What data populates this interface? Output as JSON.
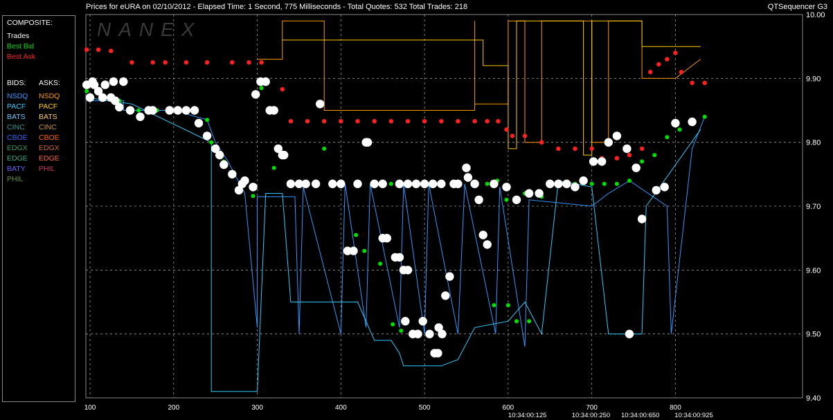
{
  "header": {
    "title_left": "Prices for  eURA  on  02/10/2012  -  Elapsed Time: 1 Second, 775 Milliseconds   -  Total Quotes: 532  Total Trades: 218",
    "title_right": "QTSequencer G3"
  },
  "watermark": "NANEX",
  "legend": {
    "composite_heading": "COMPOSITE:",
    "composite": [
      {
        "label": "Trades",
        "color": "#ffffff"
      },
      {
        "label": "Best Bid",
        "color": "#00e000"
      },
      {
        "label": "Best Ask",
        "color": "#ff2020"
      }
    ],
    "bids_heading": "BIDS:",
    "asks_heading": "ASKS:",
    "bids": [
      {
        "label": "NSDQ",
        "color": "#3399ff"
      },
      {
        "label": "PACF",
        "color": "#33ccff"
      },
      {
        "label": "BATS",
        "color": "#66ccff"
      },
      {
        "label": "CINC",
        "color": "#339999"
      },
      {
        "label": "CBOE",
        "color": "#3366ff"
      },
      {
        "label": "EDGX",
        "color": "#339966"
      },
      {
        "label": "EDGE",
        "color": "#33aa88"
      },
      {
        "label": "BATY",
        "color": "#6666ff"
      },
      {
        "label": "PHIL",
        "color": "#669933"
      }
    ],
    "asks": [
      {
        "label": "NSDQ",
        "color": "#ff9900"
      },
      {
        "label": "PACF",
        "color": "#ffcc00"
      },
      {
        "label": "BATS",
        "color": "#ffcc66"
      },
      {
        "label": "CINC",
        "color": "#cc9933"
      },
      {
        "label": "CBOE",
        "color": "#ff6600"
      },
      {
        "label": "EDGX",
        "color": "#cc6633"
      },
      {
        "label": "EDGE",
        "color": "#ff6633"
      },
      {
        "label": "PHIL",
        "color": "#cc3366"
      }
    ]
  },
  "chart_data": {
    "type": "scatter",
    "xlim": [
      95,
      952
    ],
    "ylim": [
      9.4,
      10.0
    ],
    "y_ticks": [
      "10.00",
      "9.90",
      "9.80",
      "9.70",
      "9.60",
      "9.50",
      "9.40"
    ],
    "x_ticks": [
      "100",
      "200",
      "300",
      "400",
      "500",
      "600",
      "700",
      "800"
    ],
    "time_labels": [
      {
        "x": 623,
        "label": "10:34:00:125"
      },
      {
        "x": 699,
        "label": "10:34:00:250"
      },
      {
        "x": 758,
        "label": "10:34:00:650"
      },
      {
        "x": 822,
        "label": "10:34:00:925"
      }
    ],
    "grid": true,
    "colors": {
      "trades": "#ffffff",
      "best_bid": "#00e000",
      "best_ask": "#ff2020",
      "grid": "#9a9a9a",
      "axis_text": "#ffffff"
    },
    "series": [
      {
        "name": "Best Ask",
        "points": [
          [
            96,
            9.945
          ],
          [
            110,
            9.945
          ],
          [
            125,
            9.943
          ],
          [
            150,
            9.925
          ],
          [
            175,
            9.925
          ],
          [
            190,
            9.925
          ],
          [
            215,
            9.925
          ],
          [
            240,
            9.925
          ],
          [
            270,
            9.925
          ],
          [
            290,
            9.925
          ],
          [
            305,
            9.925
          ],
          [
            330,
            9.883
          ],
          [
            340,
            9.833
          ],
          [
            360,
            9.833
          ],
          [
            380,
            9.833
          ],
          [
            400,
            9.833
          ],
          [
            420,
            9.833
          ],
          [
            440,
            9.833
          ],
          [
            460,
            9.833
          ],
          [
            480,
            9.833
          ],
          [
            500,
            9.833
          ],
          [
            520,
            9.833
          ],
          [
            540,
            9.833
          ],
          [
            560,
            9.833
          ],
          [
            575,
            9.833
          ],
          [
            588,
            9.833
          ],
          [
            598,
            9.82
          ],
          [
            605,
            9.81
          ],
          [
            620,
            9.81
          ],
          [
            640,
            9.8
          ],
          [
            660,
            9.79
          ],
          [
            680,
            9.79
          ],
          [
            700,
            9.79
          ],
          [
            712,
            9.775
          ],
          [
            730,
            9.775
          ],
          [
            745,
            9.78
          ],
          [
            760,
            9.79
          ],
          [
            770,
            9.91
          ],
          [
            780,
            9.922
          ],
          [
            790,
            9.93
          ],
          [
            800,
            9.94
          ],
          [
            807,
            9.91
          ],
          [
            820,
            9.893
          ],
          [
            835,
            9.893
          ]
        ]
      },
      {
        "name": "Best Bid",
        "points": [
          [
            96,
            9.88
          ],
          [
            115,
            9.87
          ],
          [
            135,
            9.865
          ],
          [
            158,
            9.85
          ],
          [
            180,
            9.85
          ],
          [
            200,
            9.85
          ],
          [
            215,
            9.85
          ],
          [
            240,
            9.835
          ],
          [
            245,
            9.8
          ],
          [
            260,
            9.77
          ],
          [
            280,
            9.73
          ],
          [
            295,
            9.716
          ],
          [
            305,
            9.885
          ],
          [
            320,
            9.76
          ],
          [
            340,
            9.735
          ],
          [
            360,
            9.735
          ],
          [
            380,
            9.79
          ],
          [
            400,
            9.735
          ],
          [
            420,
            9.735
          ],
          [
            440,
            9.735
          ],
          [
            460,
            9.735
          ],
          [
            480,
            9.735
          ],
          [
            500,
            9.735
          ],
          [
            520,
            9.735
          ],
          [
            540,
            9.735
          ],
          [
            560,
            9.735
          ],
          [
            575,
            9.735
          ],
          [
            583,
            9.735
          ],
          [
            587,
            9.74
          ],
          [
            598,
            9.71
          ],
          [
            620,
            9.72
          ],
          [
            640,
            9.715
          ],
          [
            660,
            9.735
          ],
          [
            680,
            9.735
          ],
          [
            700,
            9.735
          ],
          [
            715,
            9.735
          ],
          [
            730,
            9.735
          ],
          [
            745,
            9.74
          ],
          [
            760,
            9.77
          ],
          [
            775,
            9.78
          ],
          [
            790,
            9.808
          ],
          [
            805,
            9.82
          ],
          [
            820,
            9.83
          ],
          [
            835,
            9.84
          ],
          [
            418,
            9.655
          ],
          [
            428,
            9.63
          ],
          [
            447,
            9.61
          ],
          [
            462,
            9.515
          ],
          [
            472,
            9.505
          ],
          [
            583,
            9.545
          ],
          [
            600,
            9.545
          ],
          [
            610,
            9.52
          ],
          [
            625,
            9.52
          ]
        ]
      },
      {
        "name": "Trades",
        "points": [
          [
            96,
            9.89
          ],
          [
            100,
            9.87
          ],
          [
            103,
            9.895
          ],
          [
            105,
            9.89
          ],
          [
            110,
            9.88
          ],
          [
            115,
            9.87
          ],
          [
            118,
            9.89
          ],
          [
            125,
            9.87
          ],
          [
            128,
            9.895
          ],
          [
            130,
            9.865
          ],
          [
            135,
            9.855
          ],
          [
            140,
            9.895
          ],
          [
            148,
            9.85
          ],
          [
            160,
            9.84
          ],
          [
            170,
            9.85
          ],
          [
            175,
            9.85
          ],
          [
            195,
            9.85
          ],
          [
            205,
            9.85
          ],
          [
            215,
            9.85
          ],
          [
            225,
            9.85
          ],
          [
            230,
            9.83
          ],
          [
            240,
            9.81
          ],
          [
            250,
            9.79
          ],
          [
            255,
            9.78
          ],
          [
            260,
            9.765
          ],
          [
            270,
            9.75
          ],
          [
            278,
            9.725
          ],
          [
            282,
            9.735
          ],
          [
            285,
            9.74
          ],
          [
            295,
            9.73
          ],
          [
            298,
            9.875
          ],
          [
            304,
            9.895
          ],
          [
            310,
            9.895
          ],
          [
            315,
            9.85
          ],
          [
            320,
            9.85
          ],
          [
            325,
            9.79
          ],
          [
            330,
            9.78
          ],
          [
            332,
            9.78
          ],
          [
            340,
            9.735
          ],
          [
            350,
            9.735
          ],
          [
            358,
            9.735
          ],
          [
            370,
            9.735
          ],
          [
            375,
            9.86
          ],
          [
            390,
            9.735
          ],
          [
            400,
            9.735
          ],
          [
            420,
            9.735
          ],
          [
            430,
            9.8
          ],
          [
            432,
            9.8
          ],
          [
            440,
            9.735
          ],
          [
            450,
            9.735
          ],
          [
            470,
            9.735
          ],
          [
            480,
            9.735
          ],
          [
            490,
            9.735
          ],
          [
            500,
            9.735
          ],
          [
            510,
            9.735
          ],
          [
            520,
            9.735
          ],
          [
            535,
            9.735
          ],
          [
            540,
            9.735
          ],
          [
            550,
            9.76
          ],
          [
            552,
            9.745
          ],
          [
            560,
            9.735
          ],
          [
            565,
            9.71
          ],
          [
            570,
            9.655
          ],
          [
            575,
            9.64
          ],
          [
            583,
            9.735
          ],
          [
            598,
            9.73
          ],
          [
            610,
            9.71
          ],
          [
            625,
            9.72
          ],
          [
            637,
            9.72
          ],
          [
            650,
            9.735
          ],
          [
            660,
            9.735
          ],
          [
            670,
            9.735
          ],
          [
            680,
            9.73
          ],
          [
            690,
            9.74
          ],
          [
            702,
            9.77
          ],
          [
            712,
            9.77
          ],
          [
            720,
            9.8
          ],
          [
            730,
            9.81
          ],
          [
            742,
            9.79
          ],
          [
            753,
            9.76
          ],
          [
            760,
            9.68
          ],
          [
            777,
            9.725
          ],
          [
            787,
            9.73
          ],
          [
            800,
            9.83
          ],
          [
            820,
            9.832
          ],
          [
            745,
            9.5
          ],
          [
            408,
            9.63
          ],
          [
            415,
            9.63
          ],
          [
            477,
            9.52
          ],
          [
            486,
            9.5
          ],
          [
            492,
            9.5
          ],
          [
            498,
            9.52
          ],
          [
            506,
            9.5
          ],
          [
            517,
            9.51
          ],
          [
            521,
            9.5
          ],
          [
            512,
            9.47
          ],
          [
            516,
            9.47
          ],
          [
            525,
            9.56
          ],
          [
            530,
            9.59
          ],
          [
            450,
            9.65
          ],
          [
            455,
            9.65
          ],
          [
            465,
            9.62
          ],
          [
            470,
            9.62
          ],
          [
            475,
            9.6
          ],
          [
            480,
            9.6
          ]
        ]
      }
    ]
  }
}
